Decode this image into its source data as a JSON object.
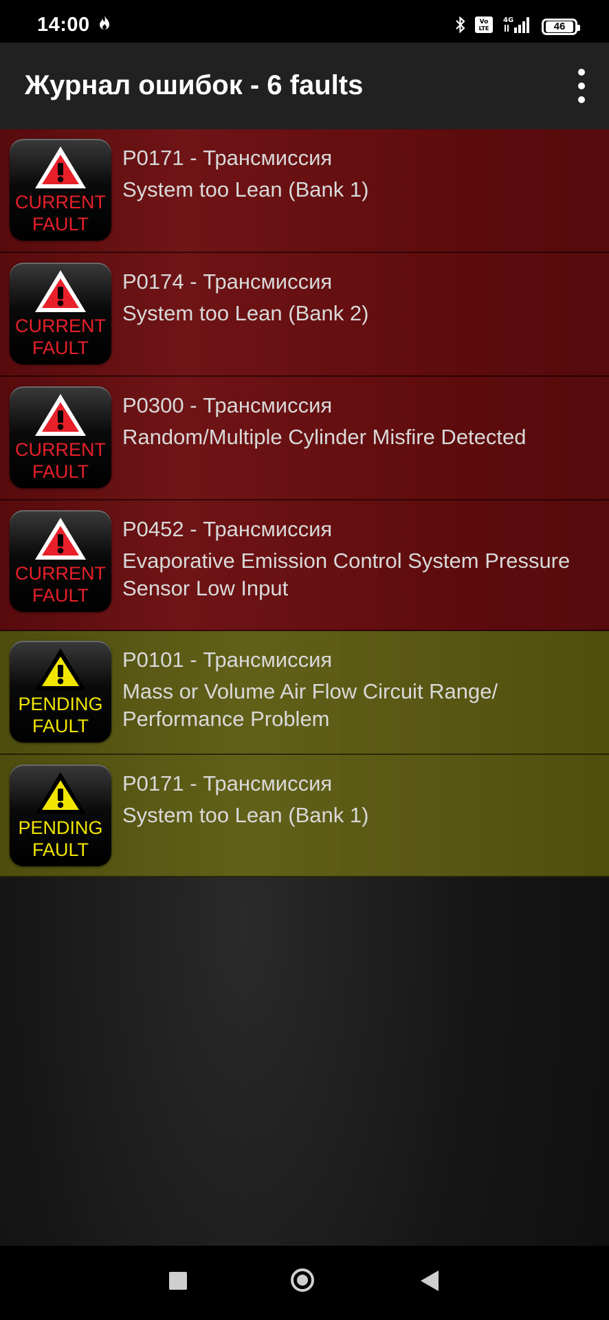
{
  "status_bar": {
    "time": "14:00",
    "volte_label": "Vo LTE",
    "network": "4G",
    "battery": "46"
  },
  "app_bar": {
    "title": "Журнал ошибок - 6 faults"
  },
  "faults": [
    {
      "type": "current",
      "badge_line1": "CURRENT",
      "badge_line2": "FAULT",
      "code": "P0171 - Трансмиссия",
      "description": "System too Lean (Bank 1)"
    },
    {
      "type": "current",
      "badge_line1": "CURRENT",
      "badge_line2": "FAULT",
      "code": "P0174 - Трансмиссия",
      "description": "System too Lean (Bank 2)"
    },
    {
      "type": "current",
      "badge_line1": "CURRENT",
      "badge_line2": "FAULT",
      "code": "P0300 - Трансмиссия",
      "description": "Random/Multiple Cylinder Misfire Detected"
    },
    {
      "type": "current",
      "badge_line1": "CURRENT",
      "badge_line2": "FAULT",
      "code": "P0452 - Трансмиссия",
      "description": "Evaporative Emission Control System Pressure Sensor Low Input"
    },
    {
      "type": "pending",
      "badge_line1": "PENDING",
      "badge_line2": "FAULT",
      "code": "P0101 - Трансмиссия",
      "description": "Mass or Volume Air Flow Circuit Range/ Performance Problem"
    },
    {
      "type": "pending",
      "badge_line1": "PENDING",
      "badge_line2": "FAULT",
      "code": "P0171 - Трансмиссия",
      "description": "System too Lean (Bank 1)"
    }
  ],
  "colors": {
    "current_row": "#6b0d0f",
    "pending_row": "#5b5a10",
    "current_text": "#e8202a",
    "pending_text": "#f2e600"
  },
  "icons": {
    "flame": "flame-icon",
    "bluetooth": "bluetooth-icon",
    "signal": "signal-icon",
    "menu": "more-vert-icon",
    "warning": "warning-triangle-icon"
  }
}
